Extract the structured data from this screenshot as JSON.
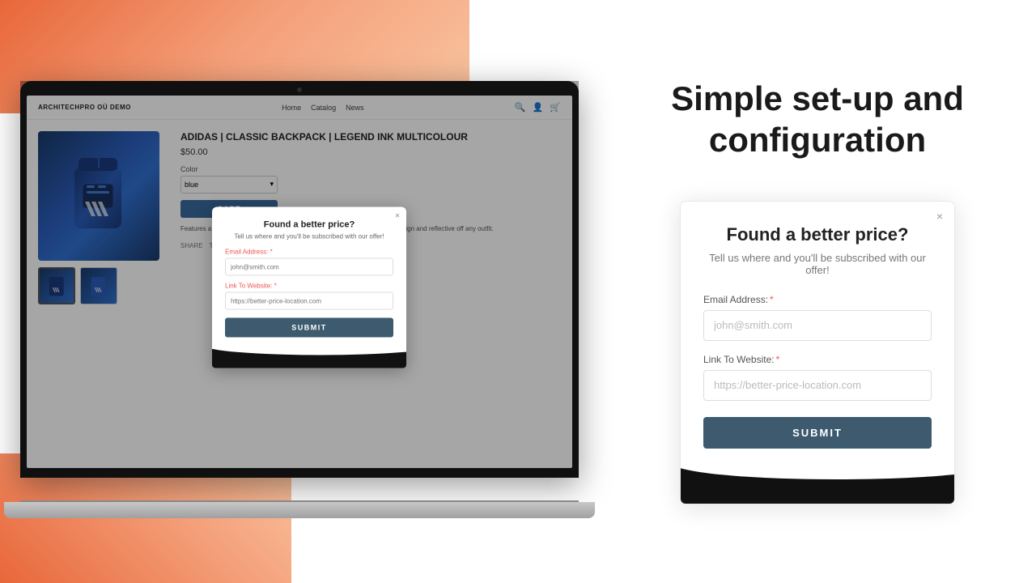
{
  "background": {
    "topLeft": "coral gradient",
    "bottomLeft": "coral gradient"
  },
  "laptop": {
    "website": {
      "header": {
        "logo": "ARCHITECHPRO OÜ DEMO",
        "nav": [
          "Home",
          "Catalog",
          "News"
        ]
      },
      "product": {
        "title": "ADIDAS | CLASSIC BACKPACK | LEGEND INK MULTICOLOUR",
        "price": "$50.00",
        "colorLabel": "Color",
        "colorValue": "blue",
        "cartButton": "CART",
        "description": "Features a pre-curved brim to keep sand-loop adjustable closure 3-Stripes design and reflective off any outfit."
      }
    },
    "smallModal": {
      "title": "Found a better price?",
      "subtitle": "Tell us where and you'll be subscribed with our offer!",
      "emailLabel": "Email Address:",
      "emailPlaceholder": "john@smith.com",
      "linkLabel": "Link To Website:",
      "linkPlaceholder": "https://better-price-location.com",
      "submitLabel": "SUBMIT",
      "closeIcon": "×"
    }
  },
  "right": {
    "heading": "Simple set-up and\nconfiguration",
    "largeModal": {
      "title": "Found a better price?",
      "subtitle": "Tell us where and you'll be subscribed with our offer!",
      "emailLabel": "Email Address:",
      "emailPlaceholder": "john@smith.com",
      "linkLabel": "Link To Website:",
      "linkPlaceholder": "https://better-price-location.com",
      "submitLabel": "SUBMIT",
      "closeIcon": "×"
    }
  }
}
